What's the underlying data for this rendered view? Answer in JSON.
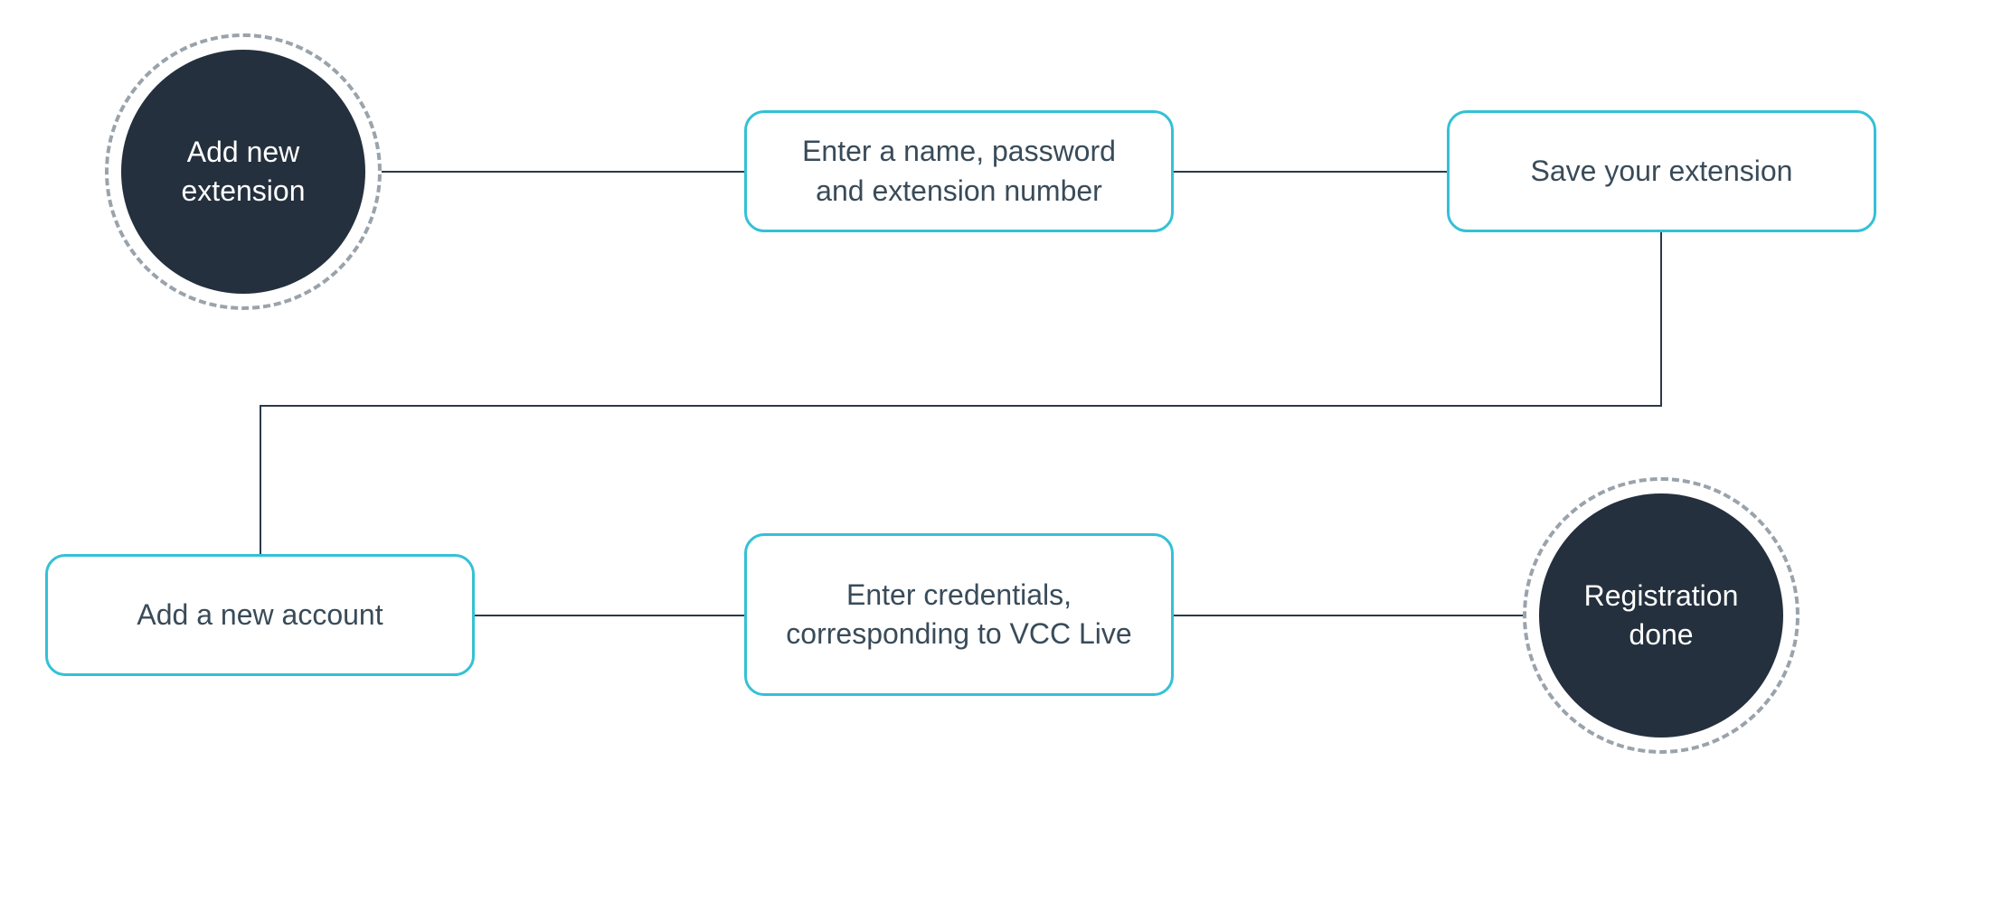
{
  "colors": {
    "box_border": "#33c1d6",
    "dark_fill": "#24303d",
    "dashed_ring": "#9aa3ab",
    "connector": "#2b3a4a",
    "text_dark": "#394b59",
    "text_light": "#ffffff"
  },
  "nodes": {
    "start": {
      "type": "circle",
      "label": "Add new extension"
    },
    "step2": {
      "type": "box",
      "label": "Enter a name, password and extension number"
    },
    "step3": {
      "type": "box",
      "label": "Save your extension"
    },
    "step4": {
      "type": "box",
      "label": "Add a new account"
    },
    "step5": {
      "type": "box",
      "label": "Enter credentials, corresponding to VCC Live"
    },
    "end": {
      "type": "circle",
      "label": "Registration done"
    }
  },
  "flow_order": [
    "start",
    "step2",
    "step3",
    "step4",
    "step5",
    "end"
  ]
}
